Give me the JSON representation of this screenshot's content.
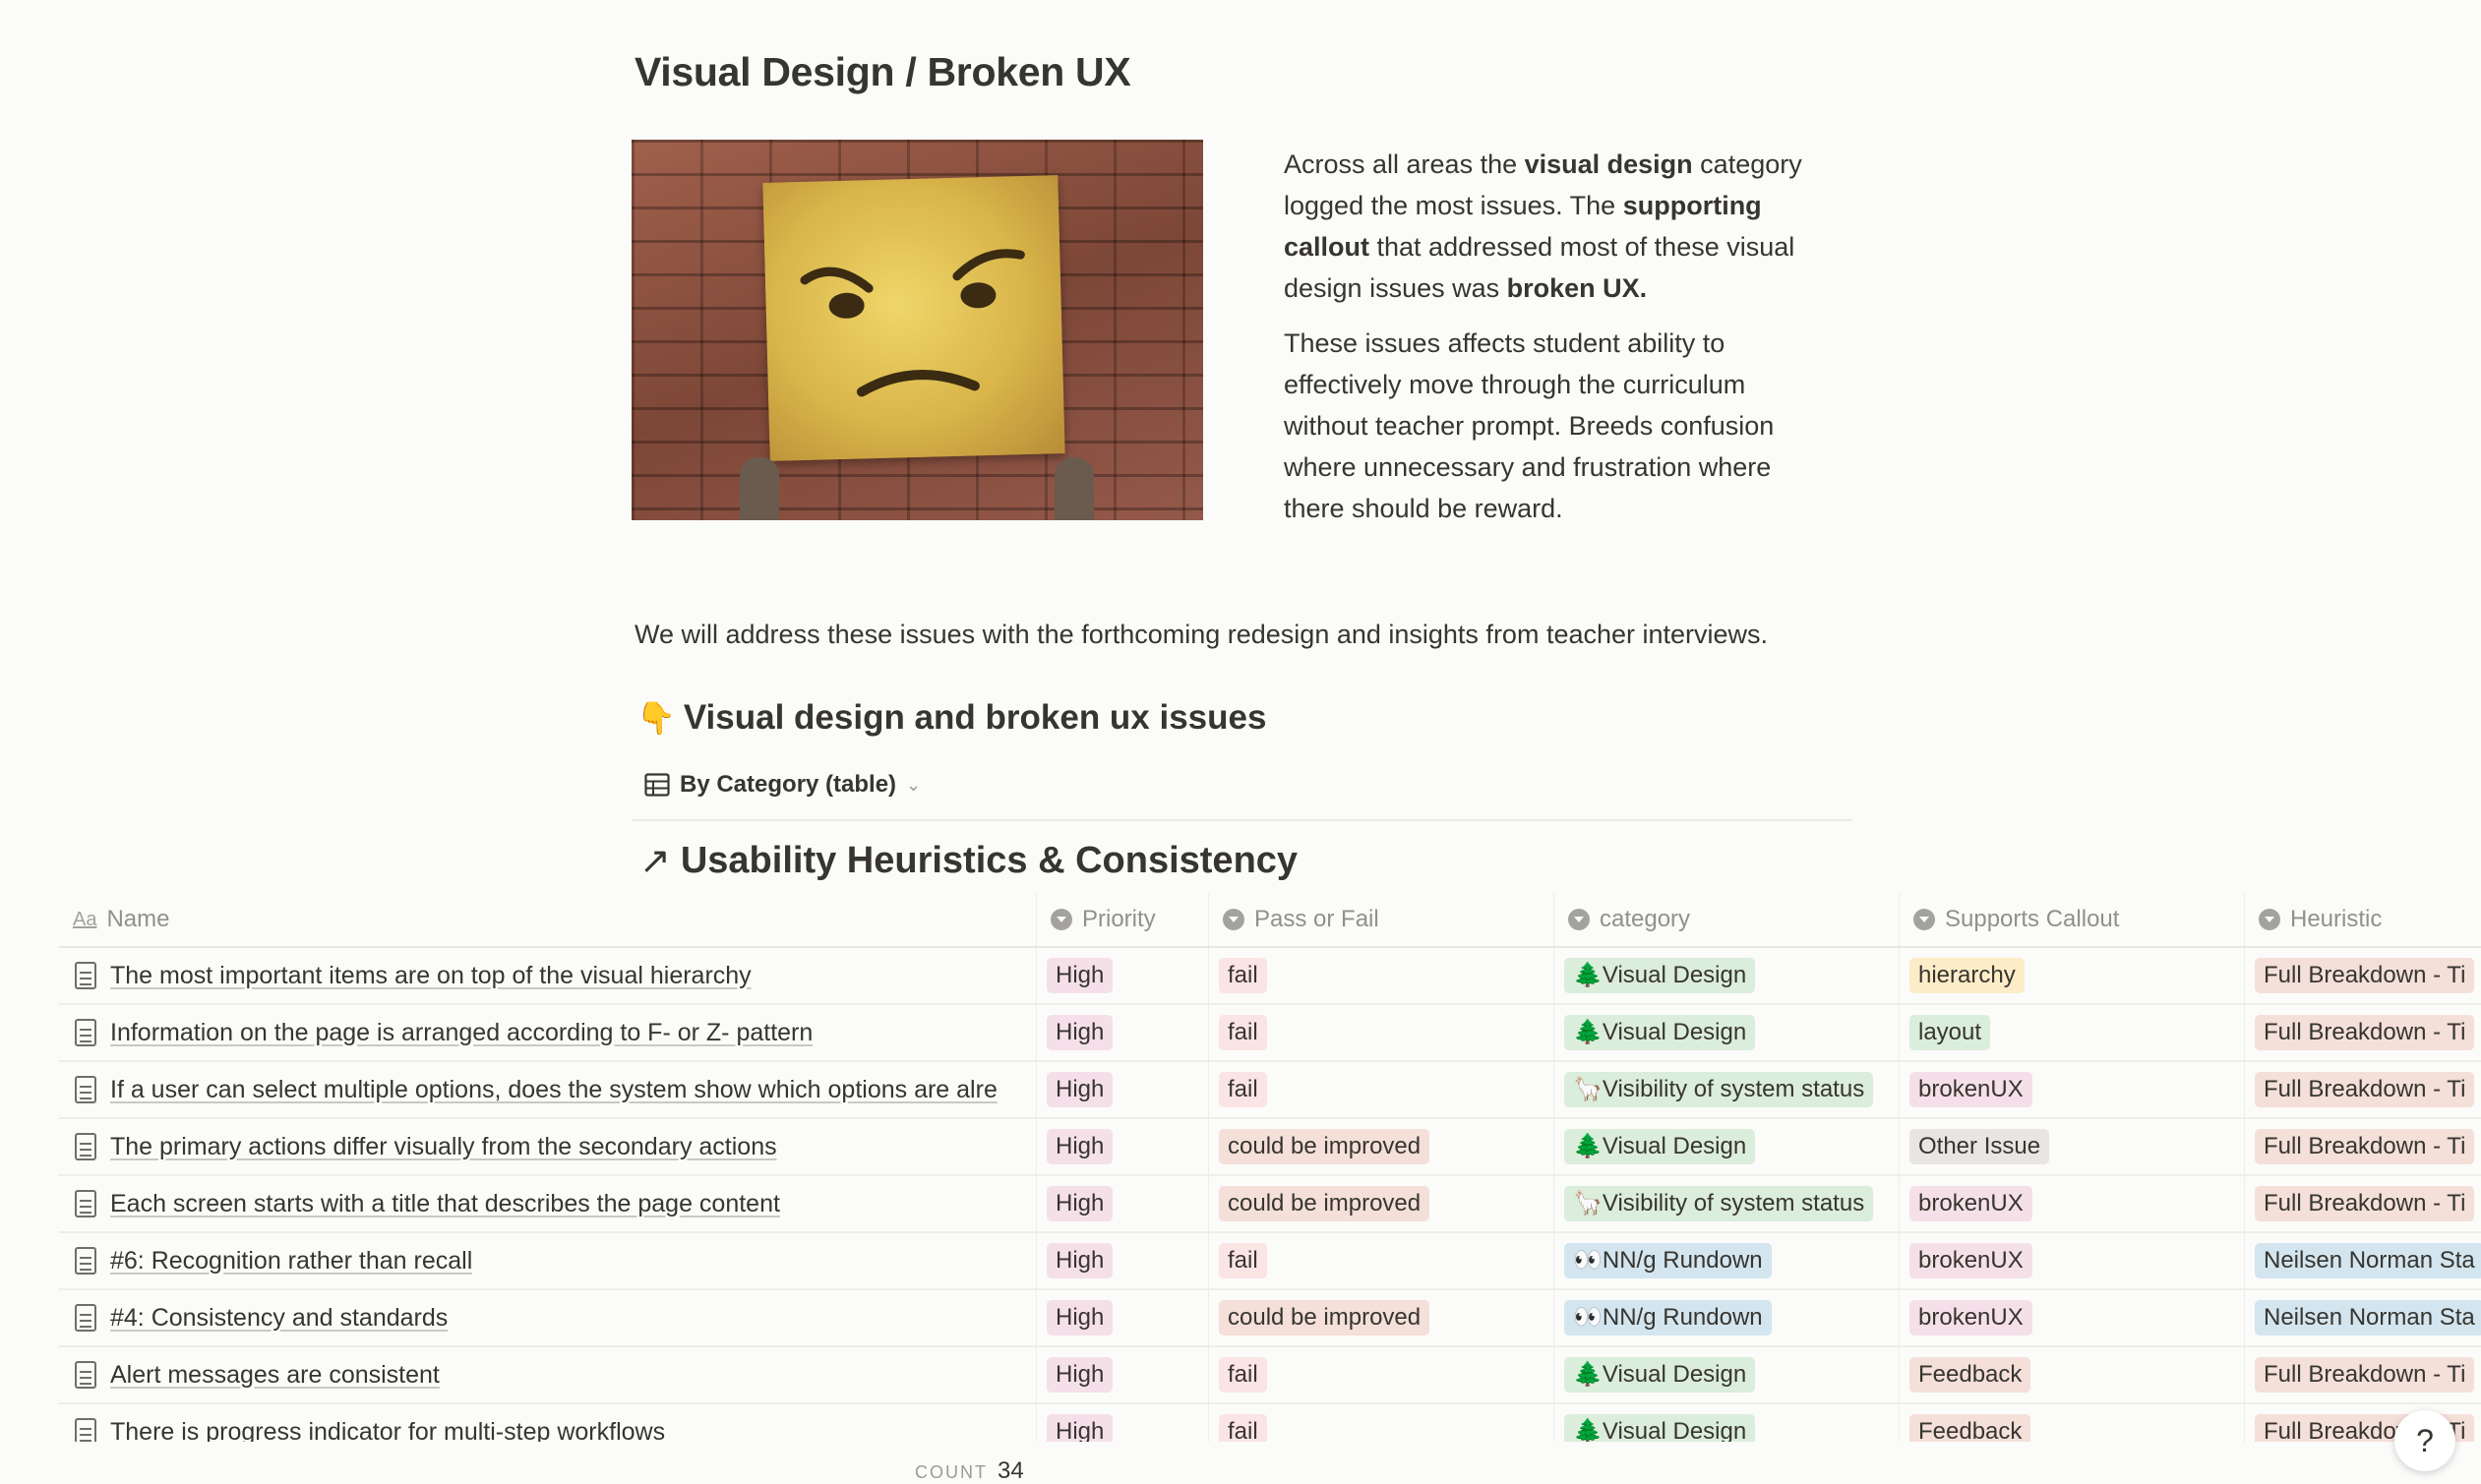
{
  "page": {
    "title": "Visual Design / Broken UX",
    "intro_p1": [
      {
        "t": "Across all areas the ",
        "b": false
      },
      {
        "t": "visual design",
        "b": true
      },
      {
        "t": " category logged the most issues. The ",
        "b": false
      },
      {
        "t": "supporting callout",
        "b": true
      },
      {
        "t": " that addressed most of these visual design issues was ",
        "b": false
      },
      {
        "t": "broken UX.",
        "b": true
      }
    ],
    "intro_p2": "These issues affects student ability to effectively move through the curriculum without teacher prompt. Breeds confusion where unnecessary and frustration where there should be reward.",
    "statement": "We will address these issues with the forthcoming redesign and insights from teacher interviews.",
    "section_emoji": "👇",
    "section_heading": "Visual design and broken ux issues",
    "view_tab": "By Category (table)",
    "linked_db_title": "Usability Heuristics & Consistency"
  },
  "table": {
    "headers": {
      "name": "Name",
      "priority": "Priority",
      "pass_fail": "Pass or Fail",
      "category": "category",
      "supports": "Supports Callout",
      "heuristic": "Heuristic"
    },
    "rows": [
      {
        "name": "The most important items are on top of the visual hierarchy",
        "priority": "High",
        "pass_fail": "fail",
        "category": "🌲Visual Design",
        "supports": "hierarchy",
        "heuristic": "Full Breakdown - Ti"
      },
      {
        "name": "Information on the page is arranged according to F- or Z- pattern",
        "priority": "High",
        "pass_fail": "fail",
        "category": "🌲Visual Design",
        "supports": "layout",
        "heuristic": "Full Breakdown - Ti"
      },
      {
        "name": "If a user can select multiple options, does the system show which options are alre",
        "priority": "High",
        "pass_fail": "fail",
        "category": "🦙Visibility of system status",
        "supports": "brokenUX",
        "heuristic": "Full Breakdown - Ti"
      },
      {
        "name": "The primary actions differ visually from the secondary actions",
        "priority": "High",
        "pass_fail": "could be improved",
        "category": "🌲Visual Design",
        "supports": "Other Issue",
        "heuristic": "Full Breakdown - Ti"
      },
      {
        "name": "Each screen starts with a title that describes the page content",
        "priority": "High",
        "pass_fail": "could be improved",
        "category": "🦙Visibility of system status",
        "supports": "brokenUX",
        "heuristic": "Full Breakdown - Ti"
      },
      {
        "name": "#6: Recognition rather than recall",
        "priority": "High",
        "pass_fail": "fail",
        "category": "👀NN/g Rundown",
        "supports": "brokenUX",
        "heuristic": "Neilsen Norman Sta"
      },
      {
        "name": "#4: Consistency and standards",
        "priority": "High",
        "pass_fail": "could be improved",
        "category": "👀NN/g Rundown",
        "supports": "brokenUX",
        "heuristic": "Neilsen Norman Sta"
      },
      {
        "name": "Alert messages are consistent",
        "priority": "High",
        "pass_fail": "fail",
        "category": "🌲Visual Design",
        "supports": "Feedback",
        "heuristic": "Full Breakdown - Ti"
      },
      {
        "name": "There is progress indicator for multi-step workflows",
        "priority": "High",
        "pass_fail": "fail",
        "category": "🌲Visual Design",
        "supports": "Feedback",
        "heuristic": "Full Breakdown - Ti"
      }
    ],
    "count_label": "COUNT",
    "count_value": "34"
  },
  "tag_colors": {
    "High": "#f5e0e9",
    "fail": "#fbe4e4",
    "could be improved": "#f4dfd9",
    "🌲Visual Design": "#dbeddb",
    "🦙Visibility of system status": "#dbeddb",
    "👀NN/g Rundown": "#d3e5ef",
    "hierarchy": "#fdecc8",
    "layout": "#dbeddb",
    "brokenUX": "#f5e0e9",
    "Other Issue": "#e9e5e3",
    "Feedback": "#f4dfd9",
    "Full Breakdown - Ti": "#f4dfd9",
    "Neilsen Norman Sta": "#d3e5ef"
  },
  "icons": {
    "help": "?",
    "view_table": "table-icon",
    "linked_arrow": "↗"
  }
}
